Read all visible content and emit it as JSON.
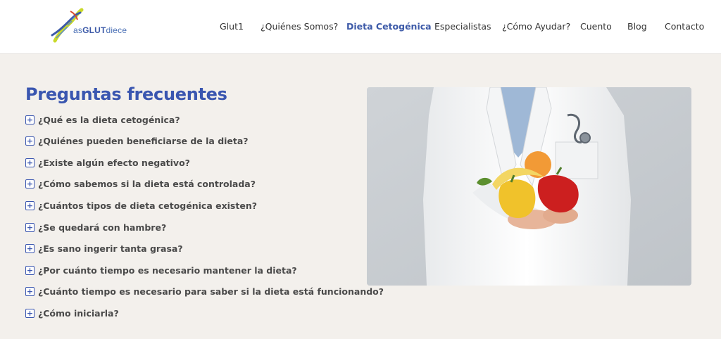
{
  "logo": {
    "part1": "as",
    "part2": "GLUT",
    "part3": "diece"
  },
  "nav": [
    {
      "label": "Glut1"
    },
    {
      "label": "¿Quiénes Somos?"
    },
    {
      "label": "Dieta Cetogénica"
    },
    {
      "label": "Especialistas"
    },
    {
      "label": "¿Cómo Ayudar?"
    },
    {
      "label": "Cuento"
    },
    {
      "label": "Blog"
    },
    {
      "label": "Contacto"
    }
  ],
  "faq": {
    "title": "Preguntas frecuentes",
    "toggle_symbol": "+",
    "items": [
      {
        "question": "¿Qué es la dieta cetogénica?"
      },
      {
        "question": "¿Quiénes pueden beneficiarse de la dieta?"
      },
      {
        "question": "¿Existe algún efecto negativo?"
      },
      {
        "question": "¿Cómo sabemos si la dieta está controlada?"
      },
      {
        "question": "¿Cuántos tipos de dieta cetogénica existen?"
      },
      {
        "question": "¿Se quedará con hambre?"
      },
      {
        "question": "¿Es sano ingerir tanta grasa?"
      },
      {
        "question": "¿Por cuánto tiempo es necesario mantener la dieta?"
      },
      {
        "question": "¿Cuánto tiempo es necesario para saber si la dieta está funcionando?"
      },
      {
        "question": "¿Cómo iniciarla?"
      }
    ]
  },
  "colors": {
    "accent": "#3a56b0",
    "background": "#f3f0ec",
    "header": "#ffffff"
  },
  "icons": {
    "logo": "dna-helix-logo",
    "faq_toggle": "plus-icon"
  }
}
